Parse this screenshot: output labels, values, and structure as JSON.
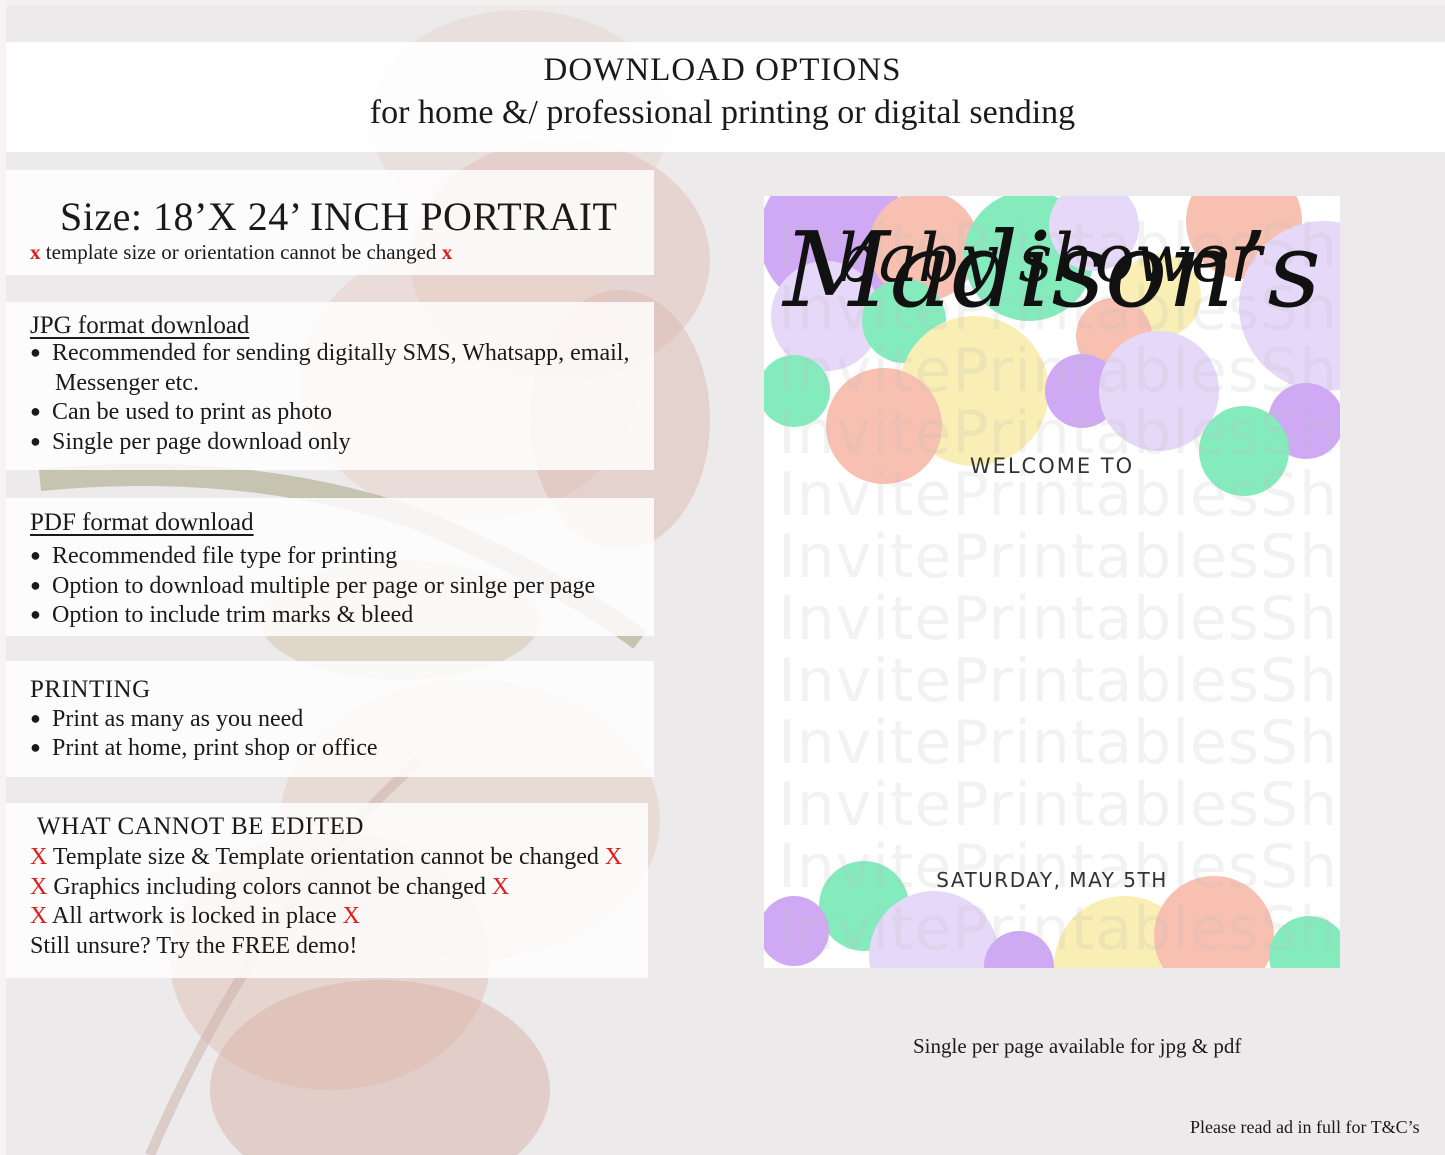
{
  "header": {
    "title": "DOWNLOAD OPTIONS",
    "subtitle": "for home &/ professional printing or digital sending"
  },
  "size": {
    "title": "Size: 18’X 24’ INCH PORTRAIT",
    "mark": "x",
    "note": " template size or orientation cannot be changed "
  },
  "jpg": {
    "heading": "JPG format download",
    "bullets": [
      "Recommended for sending digitally SMS, Whatsapp, email,",
      "Messenger etc.",
      "Can be used to print as photo",
      "Single per page download only"
    ]
  },
  "pdf": {
    "heading": "PDF format download",
    "bullets": [
      "Recommended file type for printing",
      "Option to download multiple per page or sinlge per page",
      "Option to include trim marks & bleed"
    ]
  },
  "printing": {
    "heading": "PRINTING",
    "bullets": [
      "Print as many as you need",
      "Print at home, print shop or office"
    ]
  },
  "cannot_edit": {
    "heading": "WHAT CANNOT BE EDITED",
    "mark": "X",
    "items": [
      " Template size & Template orientation cannot be changed ",
      " Graphics including colors cannot be changed ",
      " All artwork is locked in place "
    ],
    "demo": "Still unsure? Try the FREE demo!"
  },
  "poster": {
    "welcome": "WELCOME TO",
    "name": "Madison’s",
    "event": "baby shower",
    "date": "SATURDAY, MAY 5TH",
    "watermark": "InvitePrintablesShop",
    "colors": {
      "purple": "#c79bf2",
      "lavender": "#e2d2f8",
      "mint": "#6fe8b2",
      "peach": "#f7b6a4",
      "yellow": "#f9eca8"
    }
  },
  "caption": "Single per page available for jpg & pdf",
  "footer_note": "Please read ad in full for T&C’s"
}
